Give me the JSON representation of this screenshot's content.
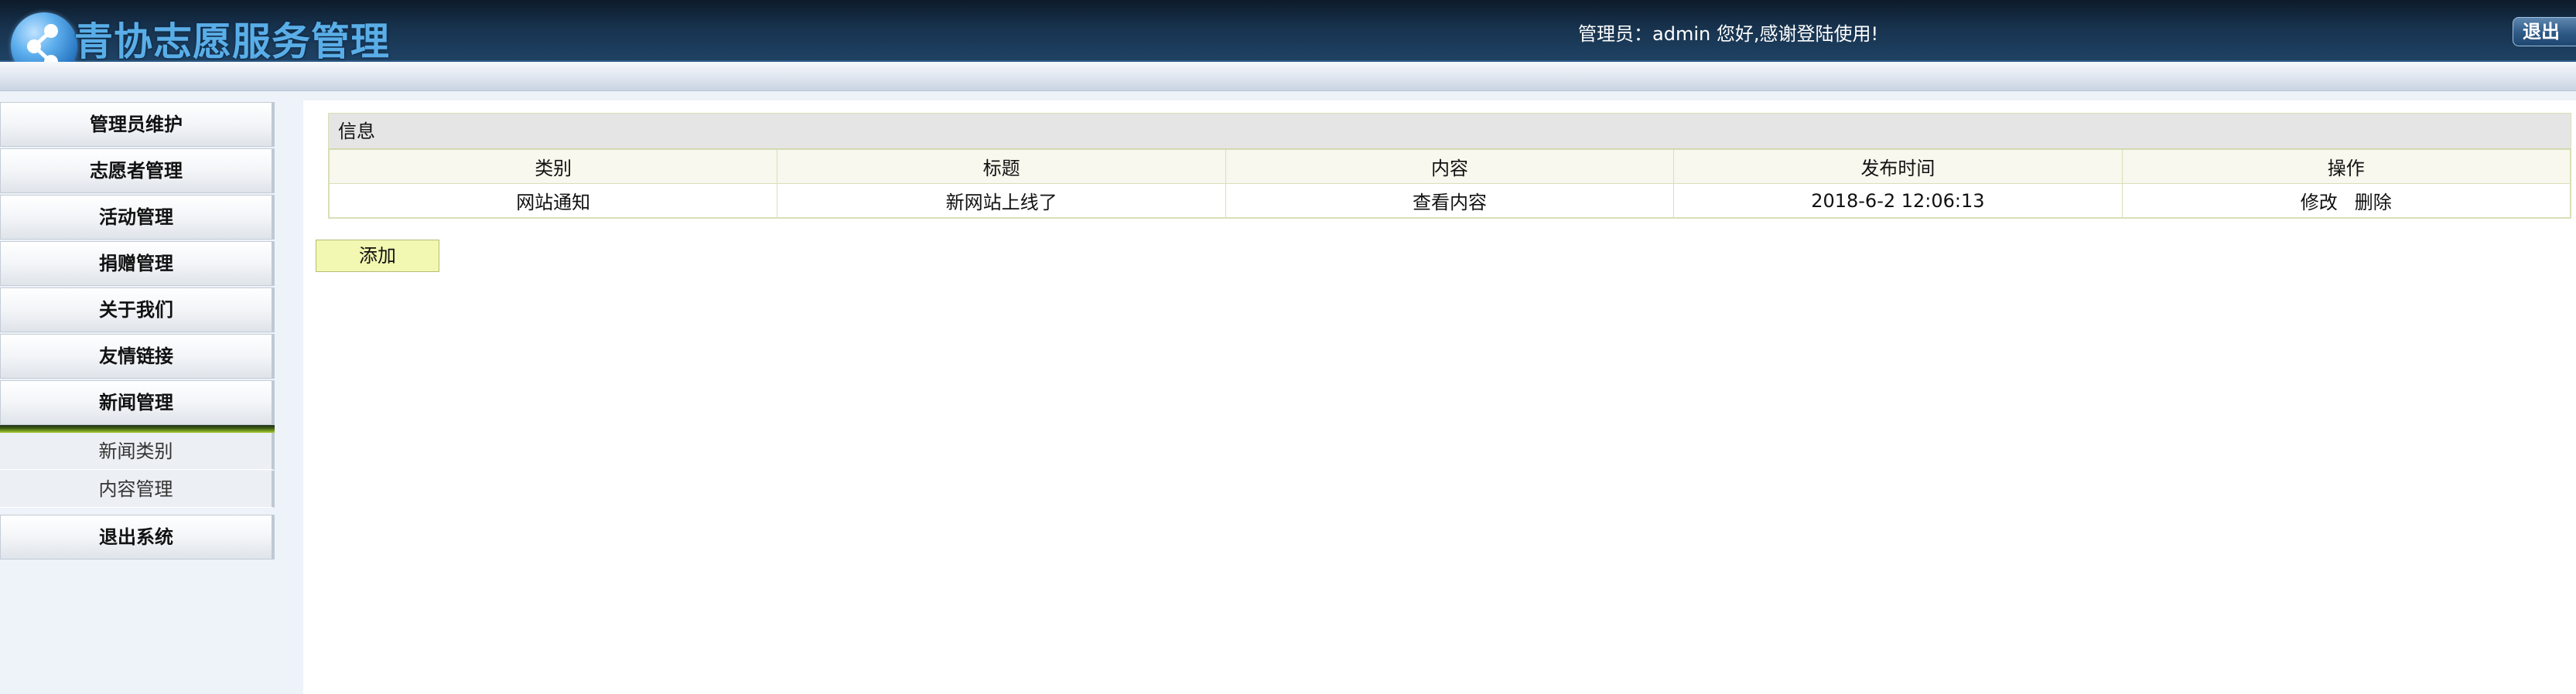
{
  "header": {
    "app_title": "青协志愿服务管理",
    "welcome_text": "管理员：admin 您好,感谢登陆使用!",
    "logout_label": "退出"
  },
  "sidebar": {
    "items": [
      {
        "label": "管理员维护"
      },
      {
        "label": "志愿者管理"
      },
      {
        "label": "活动管理"
      },
      {
        "label": "捐赠管理"
      },
      {
        "label": "关于我们"
      },
      {
        "label": "友情链接"
      },
      {
        "label": "新闻管理",
        "expanded": true
      }
    ],
    "sub_items": [
      {
        "label": "新闻类别"
      },
      {
        "label": "内容管理"
      }
    ],
    "exit_label": "退出系统"
  },
  "main": {
    "panel_title": "信息",
    "table": {
      "columns": [
        "类别",
        "标题",
        "内容",
        "发布时间",
        "操作"
      ],
      "rows": [
        {
          "category": "网站通知",
          "title": "新网站上线了",
          "content_link": "查看内容",
          "publish_time": "2018-6-2 12:06:13",
          "edit_label": "修改",
          "delete_label": "删除"
        }
      ]
    },
    "add_label": "添加"
  },
  "colors": {
    "header_bg": "#17324d",
    "title_blue": "#5aaee8",
    "table_border": "#d9dfb8",
    "add_button_bg": "#f2f7b1",
    "sidebar_bg": "#eef2f9"
  },
  "icons": {
    "logo": "share-nodes-logo-icon"
  }
}
